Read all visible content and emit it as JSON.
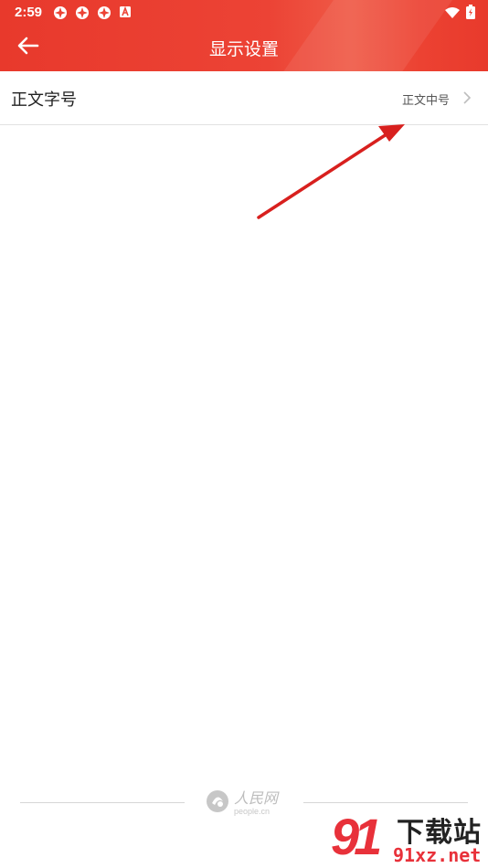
{
  "status_bar": {
    "time": "2:59",
    "notification_icons": [
      "app-notification-icon",
      "app-notification-icon",
      "app-notification-icon",
      "a-badge-icon"
    ],
    "right_icons": [
      "wifi-icon",
      "battery-charging-icon"
    ]
  },
  "header": {
    "title": "显示设置",
    "back_icon": "back-arrow-icon",
    "background_color": "#ec4335"
  },
  "settings": {
    "items": [
      {
        "label": "正文字号",
        "value": "正文中号",
        "icon": "chevron-right-icon"
      }
    ]
  },
  "footer": {
    "logo_cn": "人民网",
    "logo_en": "people.cn"
  },
  "watermark": {
    "mark": "91",
    "name": "下载站",
    "domain": "91xz.net",
    "accent_color": "#e8313a"
  },
  "annotation": {
    "arrow_color": "#d8201e"
  }
}
